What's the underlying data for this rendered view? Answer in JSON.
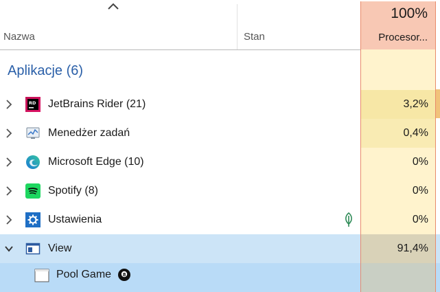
{
  "header": {
    "col_name": "Nazwa",
    "col_status": "Stan",
    "cpu_percent": "100%",
    "col_cpu": "Procesor..."
  },
  "group": {
    "label": "Aplikacje (6)"
  },
  "rows": [
    {
      "label": "JetBrains Rider (21)",
      "cpu": "3,2%",
      "icon": "jetbrains-rider-icon",
      "cpu_heat_color": "#f7e7a6"
    },
    {
      "label": "Menedżer zadań",
      "cpu": "0,4%",
      "icon": "task-manager-icon",
      "cpu_heat_color": "#f9ebb3"
    },
    {
      "label": "Microsoft Edge (10)",
      "cpu": "0%",
      "icon": "edge-icon",
      "cpu_heat_color": "#fff3cd"
    },
    {
      "label": "Spotify (8)",
      "cpu": "0%",
      "icon": "spotify-icon",
      "cpu_heat_color": "#fff3cd"
    },
    {
      "label": "Ustawienia",
      "cpu": "0%",
      "icon": "settings-icon",
      "status_icon": "eco-leaf-icon",
      "cpu_heat_color": "#fff3cd"
    },
    {
      "label": "View",
      "cpu": "91,4%",
      "icon": "view-window-icon",
      "expanded": true,
      "selected": true,
      "cpu_heat_color": "#d9d2b8"
    }
  ],
  "child_row": {
    "label": "Pool Game",
    "icon": "window-icon",
    "trailing_icon": "8-ball-icon",
    "cpu": ""
  }
}
